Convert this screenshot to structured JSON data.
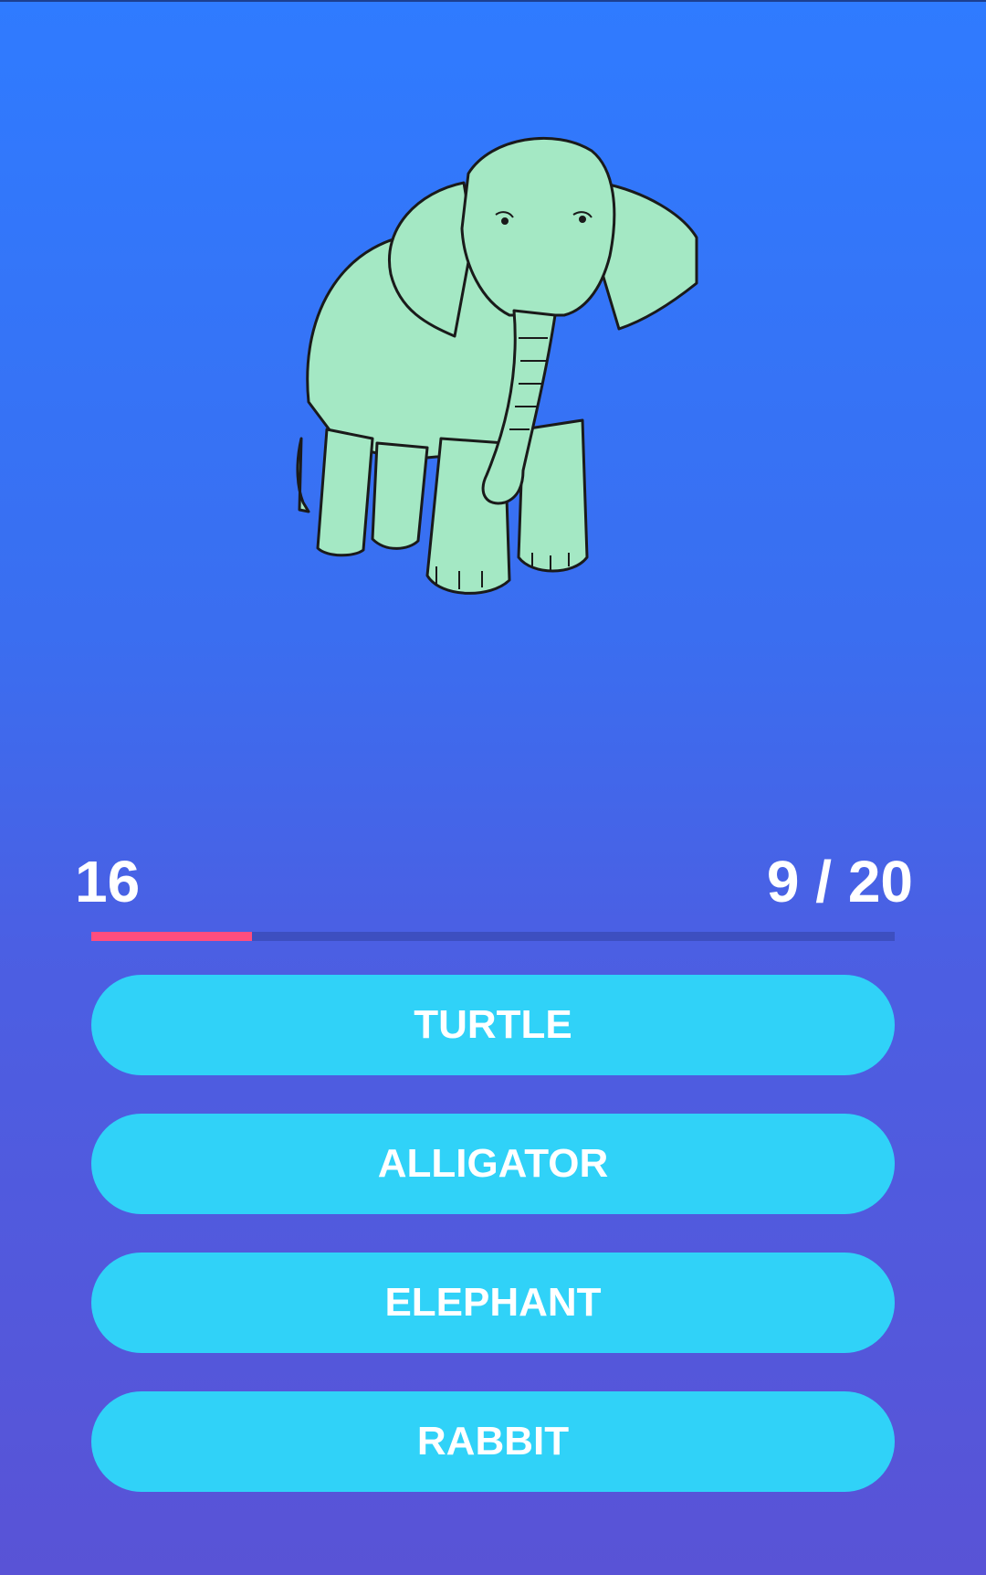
{
  "quiz": {
    "picture_icon": "elephant-illustration",
    "score": "16",
    "progress_label": "9 / 20",
    "progress_fraction": 0.2,
    "answers": [
      {
        "label": "TURTLE"
      },
      {
        "label": "ALLIGATOR"
      },
      {
        "label": "ELEPHANT"
      },
      {
        "label": "RABBIT"
      }
    ]
  },
  "colors": {
    "background_top": "#2f7bff",
    "background_bottom": "#5953d6",
    "button": "#30d2f8",
    "progress_fill": "#ff4d7e",
    "progress_track": "#3d4fc0",
    "text": "#ffffff",
    "elephant_body": "#a4e8c4"
  }
}
